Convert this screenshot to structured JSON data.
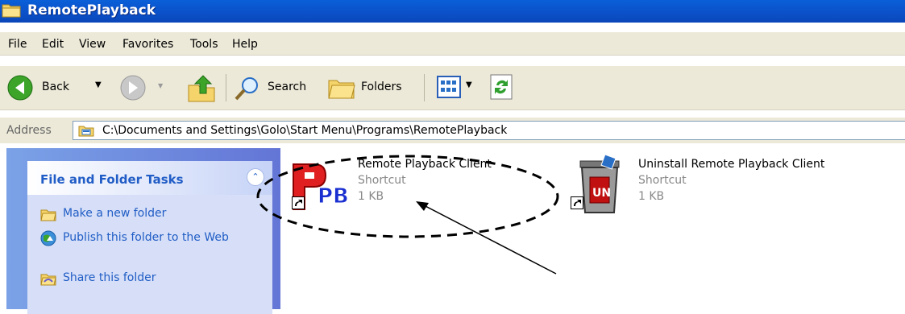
{
  "window": {
    "title": "RemotePlayback"
  },
  "menubar": {
    "items": [
      "File",
      "Edit",
      "View",
      "Favorites",
      "Tools",
      "Help"
    ]
  },
  "toolbar": {
    "back_label": "Back",
    "search_label": "Search",
    "folders_label": "Folders"
  },
  "address": {
    "label": "Address",
    "path": "C:\\Documents and Settings\\Golo\\Start Menu\\Programs\\RemotePlayback"
  },
  "tasks_panel": {
    "title": "File and Folder Tasks",
    "items": [
      {
        "label": "Make a new folder",
        "icon": "new-folder-icon"
      },
      {
        "label": "Publish this folder to the Web",
        "icon": "publish-web-icon"
      },
      {
        "label": "Share this folder",
        "icon": "share-folder-icon"
      }
    ]
  },
  "files": [
    {
      "name": "Remote Playback Client",
      "type": "Shortcut",
      "size": "1 KB",
      "icon": "rpb-app-icon"
    },
    {
      "name": "Uninstall Remote Playback Client",
      "type": "Shortcut",
      "size": "1 KB",
      "icon": "uninstall-trash-icon"
    }
  ],
  "colors": {
    "title_bar": "#0a5fd8",
    "task_text": "#215dc6",
    "annotation": "#000000"
  }
}
